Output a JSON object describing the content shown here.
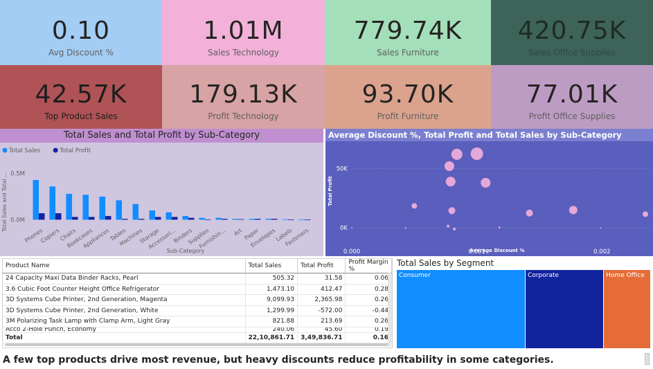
{
  "kpis": {
    "avg_discount": {
      "value": "0.10",
      "label": "Avg Discount %"
    },
    "sales_technology": {
      "value": "1.01M",
      "label": "Sales Technology"
    },
    "sales_furniture": {
      "value": "779.74K",
      "label": "Sales Furniture"
    },
    "sales_office_supplies": {
      "value": "420.75K",
      "label": "Sales Office Supplies"
    },
    "top_product_sales": {
      "value": "42.57K",
      "label": "Top Product Sales"
    },
    "profit_technology": {
      "value": "179.13K",
      "label": "Profit Technology"
    },
    "profit_furniture": {
      "value": "93.70K",
      "label": "Profit Furniture"
    },
    "profit_office_supplies": {
      "value": "77.01K",
      "label": "Profit Office Supplies"
    }
  },
  "colors": {
    "kpi_blue": "#a3cdf5",
    "kpi_pink": "#f3b1d9",
    "kpi_green": "#a3dfb9",
    "kpi_darkgreen": "#3e6359",
    "kpi_red": "#b05356",
    "kpi_rose": "#d7a3a5",
    "kpi_salmon": "#dba38d",
    "kpi_mauve": "#bd9cc4",
    "bar_sales": "#118dff",
    "bar_profit": "#12239e",
    "scatter_bg": "#5a5ebc",
    "bubble": "#e5a8d8",
    "seg_consumer": "#118dff",
    "seg_corporate": "#12239e",
    "seg_home": "#e66c37"
  },
  "chart_data": [
    {
      "type": "bar",
      "title": "Total Sales and Total Profit by Sub-Category",
      "xlabel": "Sub-Category",
      "ylabel": "Total Sales and Total ...",
      "legend": [
        "Total Sales",
        "Total Profit"
      ],
      "legend_position": "top-left",
      "y_ticks": [
        "0.0M",
        "0.5M"
      ],
      "ylim": [
        -0.05,
        0.55
      ],
      "categories": [
        "Phones",
        "Copiers",
        "Chairs",
        "Bookcases",
        "Appliances",
        "Tables",
        "Machines",
        "Storage",
        "Accessori...",
        "Binders",
        "Supplies",
        "Furnishin...",
        "Art",
        "Paper",
        "Envelopes",
        "Labels",
        "Fasteners"
      ],
      "series": [
        {
          "name": "Total Sales",
          "values": [
            0.43,
            0.36,
            0.28,
            0.27,
            0.25,
            0.21,
            0.17,
            0.1,
            0.08,
            0.04,
            0.02,
            0.02,
            0.01,
            0.01,
            0.01,
            0.004,
            0.003
          ]
        },
        {
          "name": "Total Profit",
          "values": [
            0.07,
            0.07,
            0.03,
            0.03,
            0.04,
            0.01,
            0.01,
            0.03,
            0.03,
            0.02,
            0.003,
            0.01,
            0.006,
            0.01,
            0.01,
            0.002,
            0.001
          ]
        }
      ]
    },
    {
      "type": "scatter",
      "title": "Average Discount %, Total Profit and Total Sales by Sub-Category",
      "xlabel": "Average Discount %",
      "ylabel": "Total Profit",
      "x_ticks": [
        "0.000",
        "0.001",
        "0.002"
      ],
      "y_ticks": [
        "0K",
        "50K"
      ],
      "xlim": [
        0.0,
        0.00238
      ],
      "ylim": [
        -4000,
        66000
      ],
      "points": [
        {
          "x": 0.00084,
          "y": 62000,
          "size": 8
        },
        {
          "x": 0.001,
          "y": 62500,
          "size": 9
        },
        {
          "x": 0.00078,
          "y": 52000,
          "size": 7
        },
        {
          "x": 0.00079,
          "y": 39000,
          "size": 7
        },
        {
          "x": 0.00107,
          "y": 38000,
          "size": 7
        },
        {
          "x": 0.0005,
          "y": 18500,
          "size": 4
        },
        {
          "x": 0.0008,
          "y": 14500,
          "size": 5
        },
        {
          "x": 0.00142,
          "y": 12500,
          "size": 5
        },
        {
          "x": 0.00177,
          "y": 15000,
          "size": 6
        },
        {
          "x": 0.00236,
          "y": 11500,
          "size": 4
        },
        {
          "x": 0.00077,
          "y": 1500,
          "size": 2
        },
        {
          "x": 0.00082,
          "y": -1000,
          "size": 2
        },
        {
          "x": 0.00118,
          "y": 200,
          "size": 1.5
        },
        {
          "x": 0.00043,
          "y": 0,
          "size": 1.2
        },
        {
          "x": 0.0,
          "y": 0,
          "size": 1
        },
        {
          "x": 0.00199,
          "y": 0,
          "size": 1
        }
      ]
    },
    {
      "type": "table",
      "columns": [
        "Product Name",
        "Total Sales",
        "Total Profit",
        "Profit Margin %"
      ],
      "rows": [
        [
          "24 Capacity Maxi Data Binder Racks, Pearl",
          "505.32",
          "31.58",
          "0.06"
        ],
        [
          "3.6 Cubic Foot Counter Height Office Refrigerator",
          "1,473.10",
          "412.47",
          "0.28"
        ],
        [
          "3D Systems Cube Printer, 2nd Generation, Magenta",
          "9,099.93",
          "2,365.98",
          "0.26"
        ],
        [
          "3D Systems Cube Printer, 2nd Generation, White",
          "1,299.99",
          "-572.00",
          "-0.44"
        ],
        [
          "3M Polarizing Task Lamp with Clamp Arm, Light Gray",
          "821.88",
          "213.69",
          "0.26"
        ],
        [
          "Acco 2-Hole Punch, Economy",
          "240.06",
          "45.60",
          "0.19"
        ]
      ],
      "total": [
        "Total",
        "22,10,861.71",
        "3,49,836.71",
        "0.16"
      ]
    },
    {
      "type": "treemap",
      "title": "Total Sales by Segment",
      "categories": [
        "Consumer",
        "Corporate",
        "Home Office"
      ],
      "values": [
        1161401,
        706146,
        429653
      ]
    }
  ],
  "footer": "A few top products drive most revenue, but heavy discounts reduce profitability in some categories."
}
